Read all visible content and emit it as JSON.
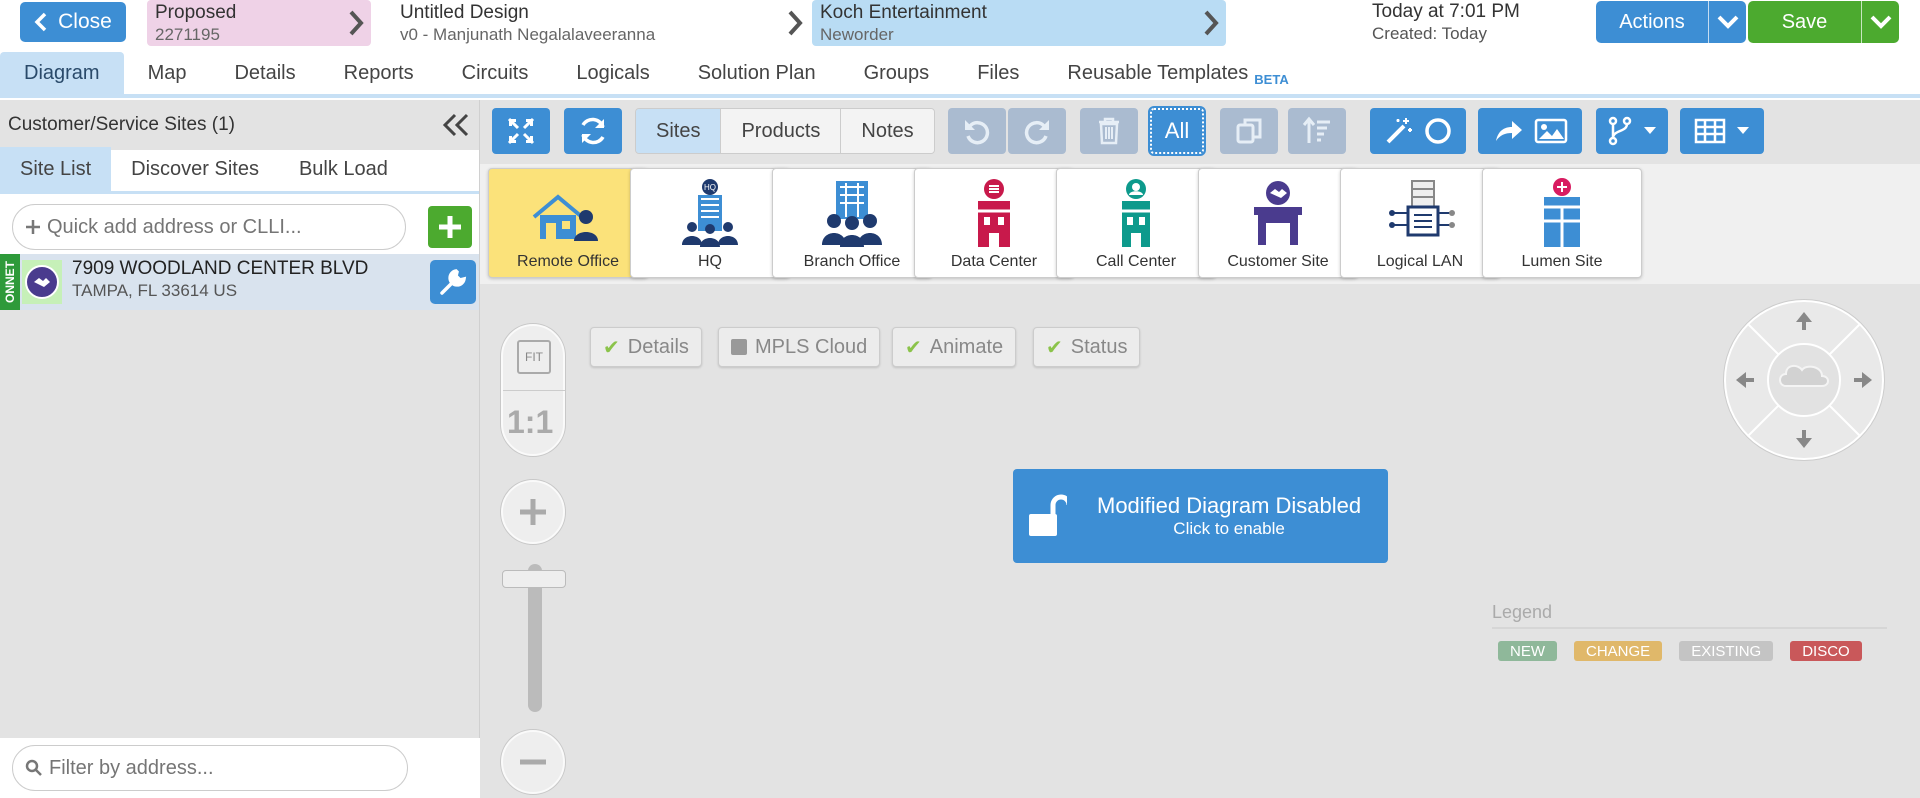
{
  "topbar": {
    "close_label": "Close",
    "status": {
      "label": "Proposed",
      "id": "2271195"
    },
    "design": {
      "title": "Untitled Design",
      "version": "v0 - Manjunath Negalalaveeranna"
    },
    "customer": {
      "name": "Koch Entertainment",
      "type": "Neworder"
    },
    "timestamp": "Today at 7:01 PM",
    "created": "Created: Today",
    "actions_label": "Actions",
    "save_label": "Save"
  },
  "tabs": [
    {
      "label": "Diagram",
      "active": true
    },
    {
      "label": "Map"
    },
    {
      "label": "Details"
    },
    {
      "label": "Reports"
    },
    {
      "label": "Circuits"
    },
    {
      "label": "Logicals"
    },
    {
      "label": "Solution Plan"
    },
    {
      "label": "Groups"
    },
    {
      "label": "Files"
    },
    {
      "label": "Reusable Templates",
      "badge": "BETA"
    }
  ],
  "sidebar": {
    "title": "Customer/Service Sites (1)",
    "tabs": [
      "Site List",
      "Discover Sites",
      "Bulk Load"
    ],
    "quick_add_placeholder": "Quick add address or CLLI...",
    "sites": [
      {
        "tag": "ONNET",
        "address": "7909 WOODLAND CENTER BLVD",
        "city": "TAMPA, FL 33614 US"
      }
    ],
    "filter_placeholder": "Filter by address..."
  },
  "toolbar": {
    "segments": [
      "Sites",
      "Products",
      "Notes"
    ],
    "all_label": "All"
  },
  "palette": [
    {
      "label": "Remote Office",
      "icon": "remote-office-icon",
      "selected": true
    },
    {
      "label": "HQ",
      "icon": "hq-icon"
    },
    {
      "label": "Branch Office",
      "icon": "branch-office-icon"
    },
    {
      "label": "Data Center",
      "icon": "data-center-icon"
    },
    {
      "label": "Call Center",
      "icon": "call-center-icon"
    },
    {
      "label": "Customer Site",
      "icon": "customer-site-icon"
    },
    {
      "label": "Logical LAN",
      "icon": "logical-lan-icon"
    },
    {
      "label": "Lumen Site",
      "icon": "lumen-site-icon"
    }
  ],
  "canvas": {
    "fit_label": "FIT",
    "one_to_one": "1:1",
    "toggles": [
      {
        "label": "Details",
        "checked": true
      },
      {
        "label": "MPLS Cloud",
        "checked": false
      },
      {
        "label": "Animate",
        "checked": true
      },
      {
        "label": "Status",
        "checked": true
      }
    ],
    "modified_title": "Modified Diagram Disabled",
    "modified_sub": "Click to enable",
    "legend_title": "Legend",
    "legend": [
      {
        "label": "NEW",
        "color": "#8fb89a"
      },
      {
        "label": "CHANGE",
        "color": "#e0b86a"
      },
      {
        "label": "EXISTING",
        "color": "#c4c4c4"
      },
      {
        "label": "DISCO",
        "color": "#c9585a"
      }
    ]
  },
  "colors": {
    "accent": "#3d8ed4",
    "save": "#4caa2f",
    "status_bg": "#efd2e7",
    "customer_bg": "#b9dcf4"
  }
}
